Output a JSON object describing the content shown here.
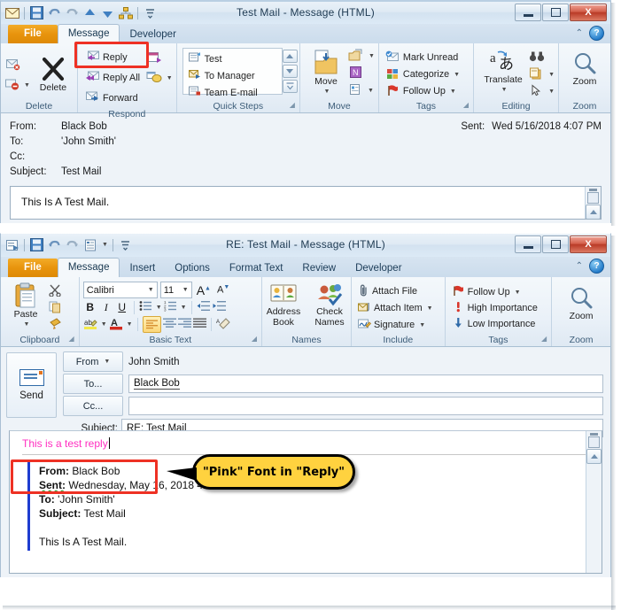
{
  "read_window": {
    "title": "Test Mail  -  Message (HTML)",
    "quick_access": [
      {
        "name": "envelope-icon",
        "label": "Message"
      },
      {
        "name": "save-icon",
        "label": "Save"
      },
      {
        "name": "undo-icon",
        "label": "Undo"
      },
      {
        "name": "redo-icon",
        "label": "Redo"
      },
      {
        "name": "previous-item-icon",
        "label": "Previous Item"
      },
      {
        "name": "next-item-icon",
        "label": "Next Item"
      },
      {
        "name": "network-icon",
        "label": "Related"
      },
      {
        "name": "customize-qat-icon",
        "label": "Customize Quick Access Toolbar"
      }
    ],
    "window_buttons": {
      "minimize": "–",
      "maximize": "□",
      "close": "X"
    },
    "tabs": [
      {
        "label": "File",
        "state": "file"
      },
      {
        "label": "Message",
        "state": "active"
      },
      {
        "label": "Developer",
        "state": "normal"
      }
    ],
    "help_icon": "?",
    "collapse_icon": "⌃",
    "ribbon": {
      "groups": [
        {
          "label": "Delete",
          "items": [
            {
              "label": "Ignore",
              "kind": "small-icon"
            },
            {
              "label": "Junk",
              "kind": "split"
            },
            {
              "label": "Delete",
              "kind": "big"
            }
          ]
        },
        {
          "label": "Respond",
          "items": [
            {
              "label": "Reply",
              "kind": "small",
              "highlighted": true
            },
            {
              "label": "Reply All",
              "kind": "small"
            },
            {
              "label": "Forward",
              "kind": "small"
            },
            {
              "label": "Meeting",
              "kind": "icon"
            },
            {
              "label": "More",
              "kind": "icon-split"
            }
          ]
        },
        {
          "label": "Quick Steps",
          "dialog_launcher": true,
          "items": [
            {
              "label": "Test",
              "kind": "gallery"
            },
            {
              "label": "To Manager",
              "kind": "gallery"
            },
            {
              "label": "Team E-mail",
              "kind": "gallery"
            }
          ]
        },
        {
          "label": "Move",
          "items": [
            {
              "label": "Move",
              "kind": "big"
            },
            {
              "label": "Rules",
              "kind": "split"
            },
            {
              "label": "OneNote",
              "kind": "icon"
            },
            {
              "label": "Actions",
              "kind": "split"
            }
          ]
        },
        {
          "label": "Tags",
          "dialog_launcher": true,
          "items": [
            {
              "label": "Mark Unread",
              "kind": "small"
            },
            {
              "label": "Categorize",
              "kind": "split"
            },
            {
              "label": "Follow Up",
              "kind": "split"
            }
          ]
        },
        {
          "label": "Editing",
          "items": [
            {
              "label": "Translate",
              "kind": "big-split"
            },
            {
              "label": "Find",
              "kind": "icon"
            },
            {
              "label": "Related",
              "kind": "icon-split"
            },
            {
              "label": "Select",
              "kind": "icon-split"
            }
          ]
        },
        {
          "label": "Zoom",
          "items": [
            {
              "label": "Zoom",
              "kind": "big"
            }
          ]
        }
      ]
    },
    "header": {
      "from_label": "From:",
      "from_value": "Black Bob",
      "to_label": "To:",
      "to_value": "'John Smith'",
      "cc_label": "Cc:",
      "cc_value": "",
      "subject_label": "Subject:",
      "subject_value": "Test Mail",
      "sent_label": "Sent:",
      "sent_value": "Wed 5/16/2018 4:07 PM"
    },
    "body_text": "This Is A Test Mail."
  },
  "compose_window": {
    "title": "RE: Test Mail  -  Message (HTML)",
    "quick_access": [
      {
        "name": "message-icon",
        "label": "Message"
      },
      {
        "name": "save-icon",
        "label": "Save"
      },
      {
        "name": "undo-icon",
        "label": "Undo"
      },
      {
        "name": "redo-icon",
        "label": "Redo"
      },
      {
        "name": "options-icon",
        "label": "Options"
      },
      {
        "name": "customize-qat-icon",
        "label": "Customize Quick Access Toolbar"
      }
    ],
    "window_buttons": {
      "minimize": "–",
      "maximize": "□",
      "close": "X"
    },
    "tabs": [
      {
        "label": "File",
        "state": "file"
      },
      {
        "label": "Message",
        "state": "active"
      },
      {
        "label": "Insert",
        "state": "normal"
      },
      {
        "label": "Options",
        "state": "normal"
      },
      {
        "label": "Format Text",
        "state": "normal"
      },
      {
        "label": "Review",
        "state": "normal"
      },
      {
        "label": "Developer",
        "state": "normal"
      }
    ],
    "help_icon": "?",
    "collapse_icon": "⌃",
    "ribbon": {
      "clipboard": {
        "label": "Clipboard",
        "paste": "Paste",
        "cut": "Cut",
        "copy": "Copy",
        "format_painter": "Format Painter",
        "dialog_launcher": true
      },
      "basic_text": {
        "label": "Basic Text",
        "font_name": "Calibri",
        "font_size": "11",
        "grow_font": "A",
        "shrink_font": "A",
        "bold": "B",
        "italic": "I",
        "underline": "U",
        "bullets": "Bullets",
        "numbering": "Numbering",
        "decrease_indent": "Decrease Indent",
        "increase_indent": "Increase Indent",
        "highlight": "Text Highlight Color",
        "font_color": "A",
        "align_left": "Align Left",
        "align_center": "Center",
        "align_right": "Align Right",
        "justify": "Justify",
        "clear_formatting": "Clear Formatting",
        "dialog_launcher": true
      },
      "names": {
        "label": "Names",
        "address_book": "Address\nBook",
        "address_book_l1": "Address",
        "address_book_l2": "Book",
        "check_names_l1": "Check",
        "check_names_l2": "Names"
      },
      "include": {
        "label": "Include",
        "attach_file": "Attach File",
        "attach_item": "Attach Item",
        "signature": "Signature"
      },
      "tags": {
        "label": "Tags",
        "follow_up": "Follow Up",
        "high_importance": "High Importance",
        "low_importance": "Low Importance",
        "dialog_launcher": true
      },
      "zoom": {
        "label": "Zoom",
        "button": "Zoom"
      }
    },
    "compose_header": {
      "send_label": "Send",
      "from_label": "From",
      "from_value": "John Smith",
      "to_label": "To...",
      "to_value": "Black Bob",
      "cc_label": "Cc...",
      "cc_value": "",
      "subject_label": "Subject:",
      "subject_value": "RE: Test Mail"
    },
    "compose_body": {
      "reply_text": "This is a test reply",
      "reply_color": "#ff2ec0",
      "quoted": {
        "from_label": "From:",
        "from_value": "Black Bob",
        "sent_label": "Sent:",
        "sent_value": "Wednesday, May 16, 2018 4:07 PM",
        "to_label": "To:",
        "to_value": "'John Smith'",
        "subject_label": "Subject:",
        "subject_value": "Test Mail",
        "body": "This Is A Test Mail."
      }
    }
  },
  "annotations": {
    "reply_highlight_color": "#ee3124",
    "pink_text_highlight_color": "#ee3124",
    "callout_text": "\"Pink\" Font in \"Reply\"",
    "callout_fill": "#ffd23f",
    "callout_border": "#000000"
  }
}
